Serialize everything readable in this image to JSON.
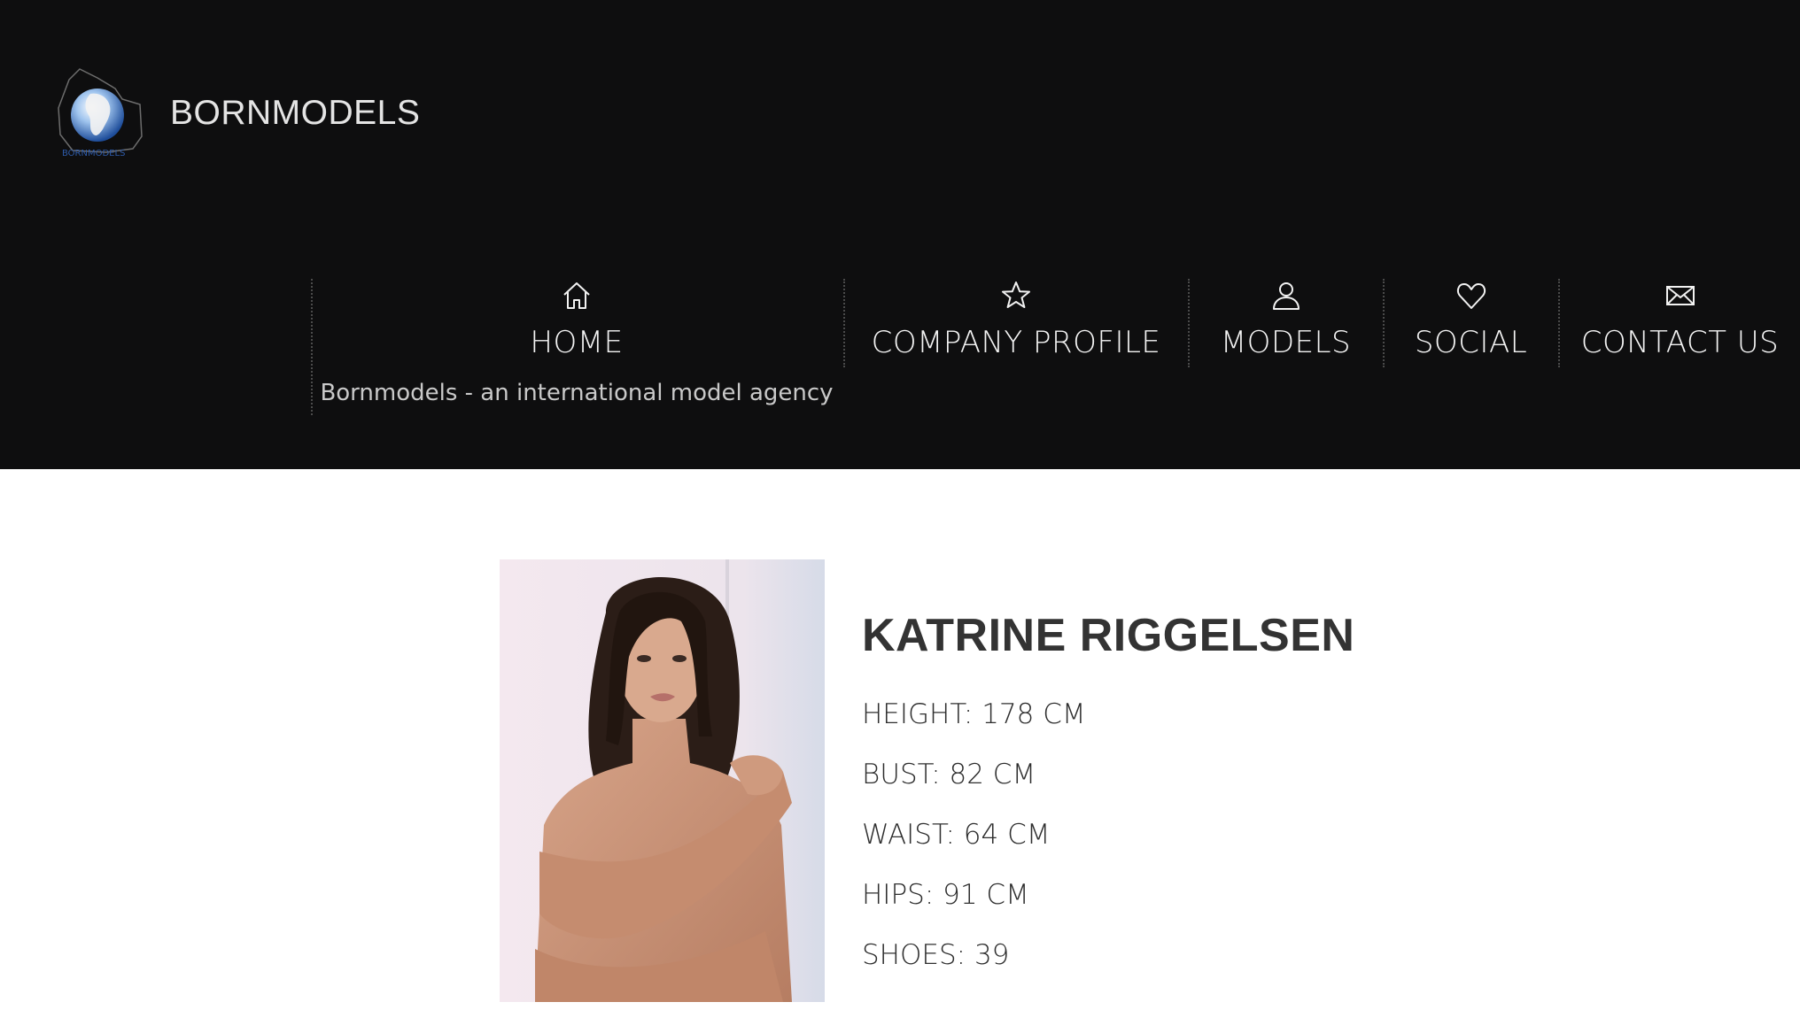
{
  "site": {
    "brand": "BORNMODELS",
    "logo_text": "BORNMODELS",
    "tagline": "Bornmodels - an international model agency"
  },
  "nav": {
    "items": [
      {
        "label": "HOME",
        "icon": "home-icon"
      },
      {
        "label": "COMPANY PROFILE",
        "icon": "star-icon"
      },
      {
        "label": "MODELS",
        "icon": "user-icon"
      },
      {
        "label": "SOCIAL",
        "icon": "heart-icon"
      },
      {
        "label": "CONTACT US",
        "icon": "envelope-icon"
      }
    ]
  },
  "model": {
    "name": "KATRINE RIGGELSEN",
    "stats": [
      "HEIGHT: 178 CM",
      "BUST: 82 CM",
      "WAIST: 64 CM",
      "HIPS: 91 CM",
      "SHOES: 39"
    ]
  },
  "colors": {
    "header_bg": "#0e0e0f",
    "nav_text": "#f4f4f4",
    "name_text": "#333333",
    "page_bg": "#ffffff"
  }
}
